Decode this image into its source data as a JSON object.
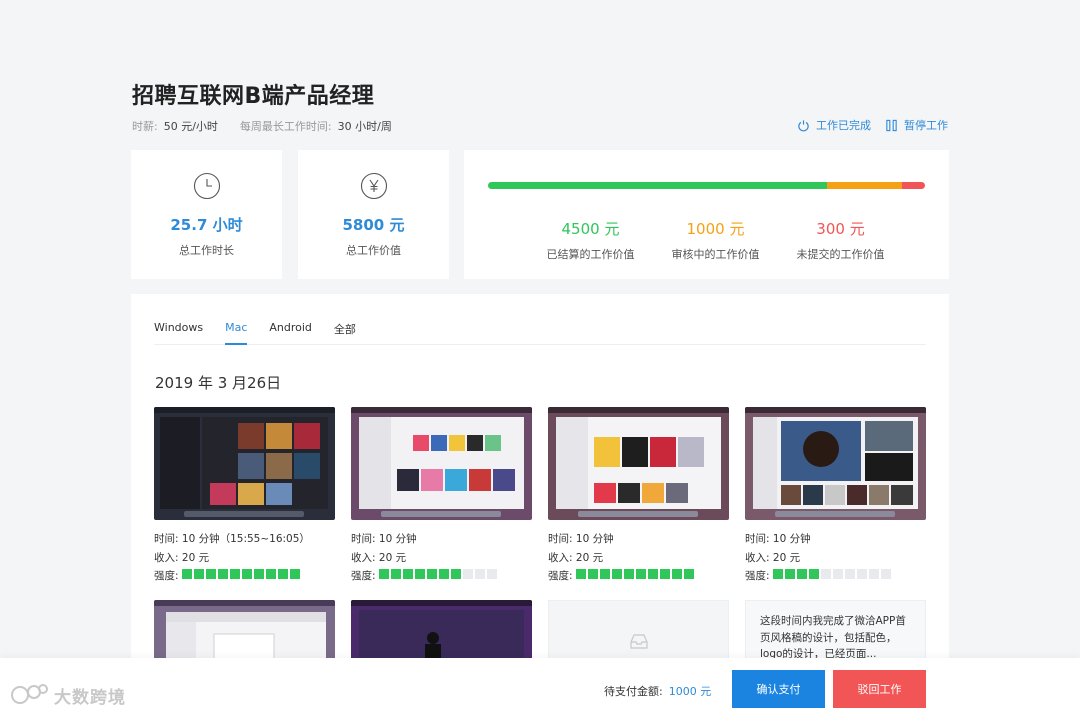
{
  "header": {
    "title": "招聘互联网B端产品经理",
    "rate_label": "时薪:",
    "rate_value": "50 元/小时",
    "hours_label": "每周最长工作时间:",
    "hours_value": "30 小时/周",
    "action_done": "工作已完成",
    "action_pause": "暂停工作"
  },
  "stats": {
    "total_hours": {
      "value": "25.7 小时",
      "label": "总工作时长",
      "icon": "clock-icon"
    },
    "total_value": {
      "value": "5800 元",
      "label": "总工作价值",
      "icon": "yen-icon"
    }
  },
  "progress": {
    "segments": [
      {
        "name": "settled",
        "value": 4500,
        "color": "#2fc65a"
      },
      {
        "name": "review",
        "value": 1000,
        "color": "#f6a115"
      },
      {
        "name": "unsubmitted",
        "value": 300,
        "color": "#f25555"
      }
    ],
    "settled": {
      "value": "4500 元",
      "label": "已结算的工作价值",
      "color": "#2fc65a"
    },
    "review": {
      "value": "1000 元",
      "label": "审核中的工作价值",
      "color": "#f6a115"
    },
    "unsubmitted": {
      "value": "300 元",
      "label": "未提交的工作价值",
      "color": "#f25555"
    }
  },
  "tabs": [
    {
      "label": "Windows",
      "active": false
    },
    {
      "label": "Mac",
      "active": true
    },
    {
      "label": "Android",
      "active": false
    },
    {
      "label": "全部",
      "active": false
    }
  ],
  "date_heading": "2019 年 3 月26日",
  "labels": {
    "time": "时间:",
    "income": "收入:",
    "intensity": "强度:"
  },
  "screenshots": [
    {
      "time": "10 分钟（15:55~16:05）",
      "income": "20 元",
      "intensity": 10,
      "max": 10
    },
    {
      "time": "10 分钟",
      "income": "20 元",
      "intensity": 7,
      "max": 10
    },
    {
      "time": "10 分钟",
      "income": "20 元",
      "intensity": 10,
      "max": 10
    },
    {
      "time": "10 分钟",
      "income": "20 元",
      "intensity": 4,
      "max": 10
    }
  ],
  "note_text": "这段时间内我完成了微洽APP首页风格稿的设计，包括配色，logo的设计，已经页面...",
  "footer": {
    "logo_text": "大数跨境",
    "due_label": "待支付金额:",
    "due_amount": "1000 元",
    "pay_button": "确认支付",
    "reject_button": "驳回工作"
  }
}
